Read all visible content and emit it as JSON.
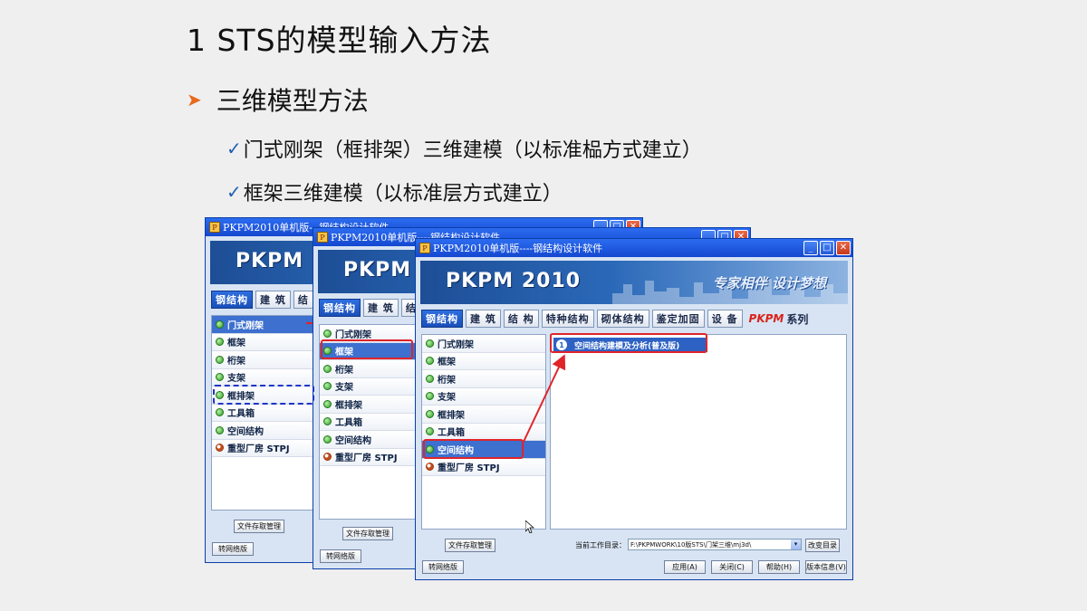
{
  "slide": {
    "title": "1  STS的模型输入方法",
    "bullet": "三维模型方法",
    "sub1": "门式刚架（框排架）三维建模（以标准榀方式建立）",
    "sub2": "框架三维建模（以标准层方式建立）"
  },
  "window": {
    "title": "PKPM2010单机版----钢结构设计软件",
    "title_partial_back": "PKPM2010单机版---钢结构设计软件",
    "title_partial_mid": "PKPM2010单机版----钢结构设计软件",
    "logo": "PKPM 2010",
    "logo_short": "PKPM 2",
    "slogan": "专家相伴 设计梦想",
    "tabs": [
      "钢结构",
      "建 筑",
      "结 构",
      "特种结构",
      "砌体结构",
      "鉴定加固",
      "设 备"
    ],
    "brand": "PKPM",
    "brand_suffix": "系列",
    "list_items": [
      "门式刚架",
      "框架",
      "桁架",
      "支架",
      "框排架",
      "工具箱",
      "空间结构",
      "重型厂房 STPJ"
    ],
    "module_num": "1",
    "module_label": "空间结构建模及分析(普及版)",
    "file_button": "文件存取管理",
    "switch_button": "转网络版",
    "dir_label": "当前工作目录：",
    "dir_value": "F:\\PKPMWORK\\10版STS\\门架三维\\mj3d\\",
    "change_dir": "改变目录",
    "apply": "应用(A)",
    "close": "关闭(C)",
    "help": "帮助(H)",
    "version": "版本信息(V)"
  },
  "colors": {
    "title_bar": "#1448d0",
    "selected": "#3d70cf",
    "highlight": "#e0242a",
    "dashed": "#1f35c8",
    "bullet_arrow": "#e8681c",
    "check": "#1f5fb5"
  }
}
